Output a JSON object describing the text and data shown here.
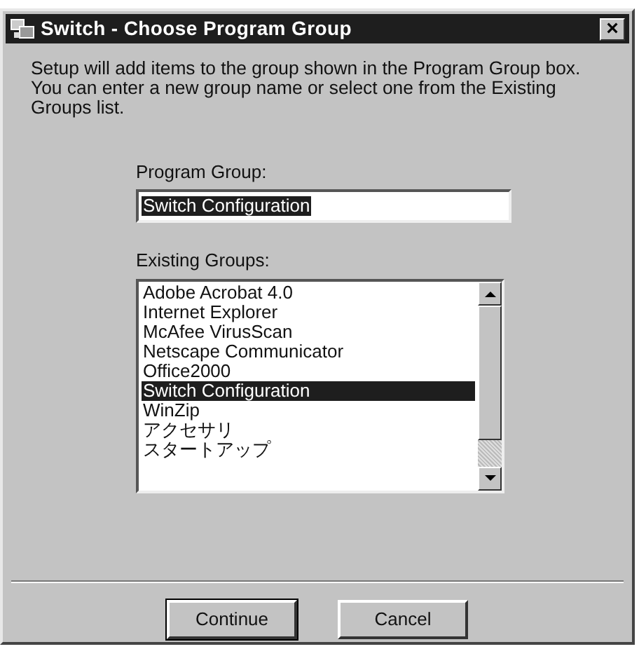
{
  "window": {
    "title": "Switch - Choose Program Group",
    "close": "×"
  },
  "instructions": "Setup will add items to the group shown in the Program Group box.  You can enter a new group name or select one from the Existing Groups list.",
  "program_group": {
    "label": "Program Group:",
    "value": "Switch Configuration",
    "value_selected": true
  },
  "existing_groups": {
    "label": "Existing Groups:",
    "items": [
      {
        "text": "Adobe Acrobat 4.0",
        "selected": false
      },
      {
        "text": "Internet Explorer",
        "selected": false
      },
      {
        "text": "McAfee VirusScan",
        "selected": false
      },
      {
        "text": "Netscape Communicator",
        "selected": false
      },
      {
        "text": "Office2000",
        "selected": false
      },
      {
        "text": "Switch Configuration",
        "selected": true
      },
      {
        "text": "WinZip",
        "selected": false
      },
      {
        "text": "アクセサリ",
        "selected": false
      },
      {
        "text": "スタートアップ",
        "selected": false
      }
    ]
  },
  "buttons": [
    {
      "label": "Continue",
      "default": true
    },
    {
      "label": "Cancel",
      "default": false
    }
  ]
}
